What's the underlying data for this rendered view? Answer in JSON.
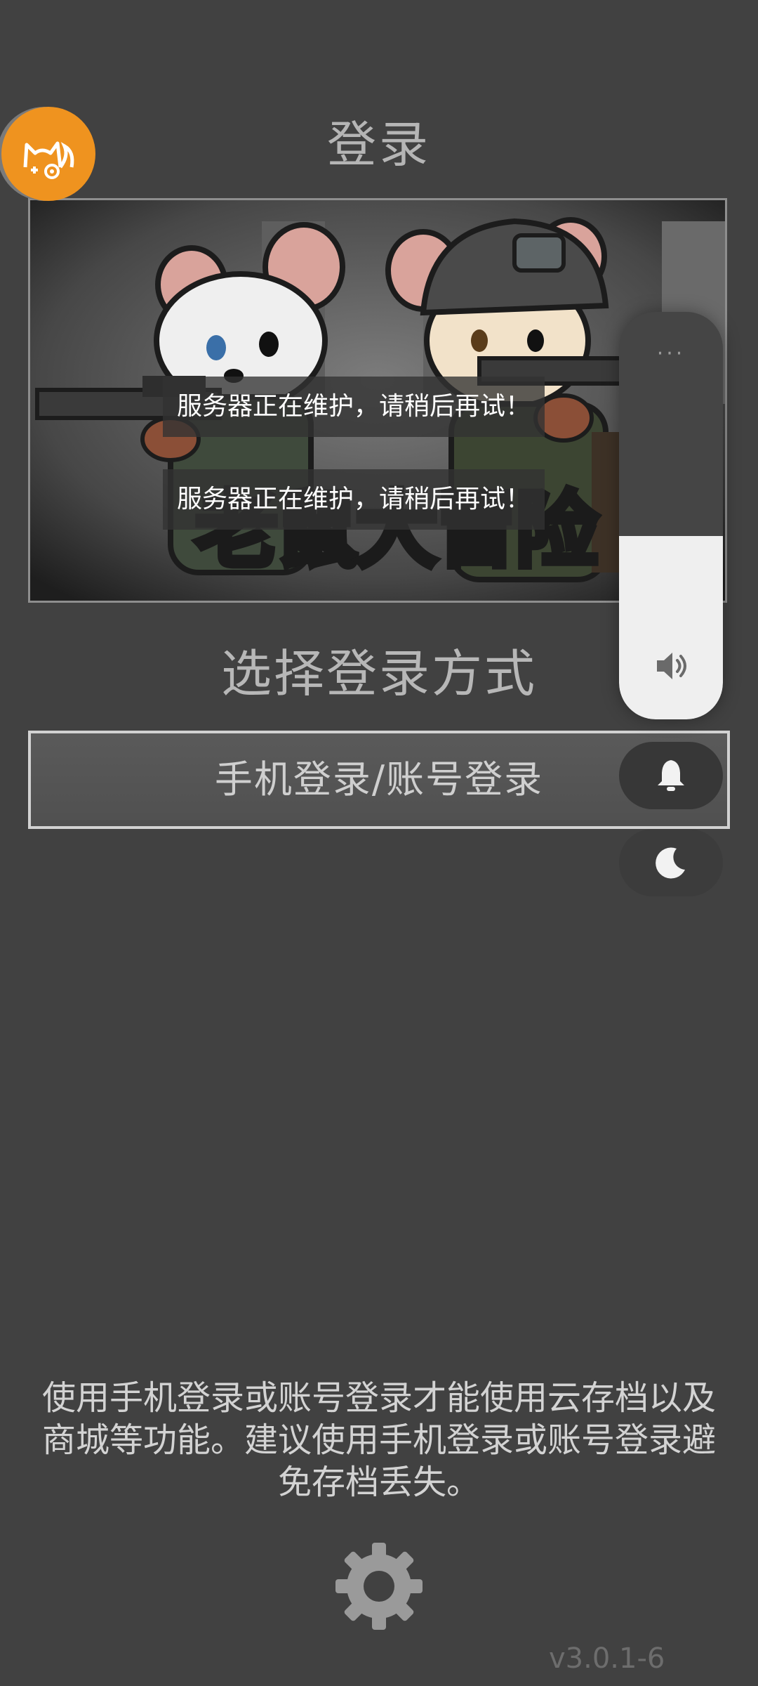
{
  "header": {
    "title": "登录"
  },
  "banner": {
    "game_logo_text": "老鼠大冒险"
  },
  "toasts": [
    "服务器正在维护，请稍后再试！",
    "服务器正在维护，请稍后再试！"
  ],
  "login": {
    "section_title": "选择登录方式",
    "phone_account_button": "手机登录/账号登录"
  },
  "volume_panel": {
    "menu_dots": "···",
    "level": 0.45
  },
  "info_text": "使用手机登录或账号登录才能使用云存档以及商城等功能。建议使用手机登录或账号登录避免存档丢失。",
  "footer": {
    "version": "v3.0.1-6"
  },
  "colors": {
    "background": "#414141",
    "accent_orange": "#ef931f",
    "text_light": "#d3d3d3"
  },
  "icons": {
    "floating_logo": "cat-logo-icon",
    "volume": "speaker-icon",
    "ring": "bell-icon",
    "dnd": "moon-icon",
    "settings": "gear-icon"
  }
}
